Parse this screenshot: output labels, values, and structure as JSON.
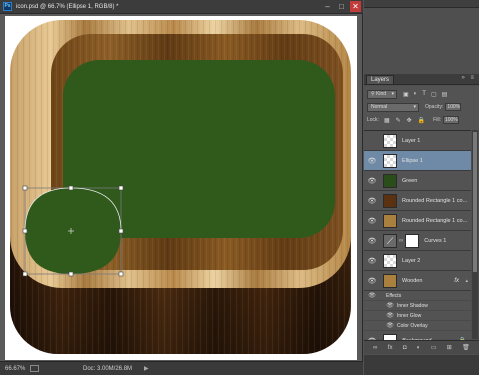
{
  "app": {
    "badge": "Ps",
    "document_title": "icon.psd @ 66.7% (Ellipse 1, RGB/8) *",
    "window_controls": [
      "–",
      "□",
      "✕"
    ]
  },
  "status": {
    "zoom": "66.67%",
    "doc_size": "Doc: 3.00M/26.8M",
    "arrow": "▶"
  },
  "layers_panel": {
    "tab": "Layers",
    "panel_controls": "»  ≡",
    "filter_kind": "Kind",
    "blend_mode": "Normal",
    "opacity_label": "Opacity:",
    "opacity_value": "100%",
    "lock_label": "Lock:",
    "fill_label": "Fill:",
    "fill_value": "100%",
    "layers": [
      {
        "name": "Layer 1",
        "visible": false,
        "thumb": "checker"
      },
      {
        "name": "Ellipse 1",
        "visible": true,
        "thumb": "checker",
        "selected": true
      },
      {
        "name": "Green",
        "visible": true,
        "thumb": "green"
      },
      {
        "name": "Rounded Rectangle 1 co...",
        "visible": true,
        "thumb": "wood-dark"
      },
      {
        "name": "Rounded Rectangle 1 co...",
        "visible": true,
        "thumb": "wood-light"
      },
      {
        "name": "Curves 1",
        "visible": true,
        "thumb": "adj"
      },
      {
        "name": "Layer 2",
        "visible": true,
        "thumb": "checker"
      },
      {
        "name": "Wooden",
        "visible": true,
        "thumb": "wood-light",
        "fx": "fx"
      }
    ],
    "effects_title": "Effects",
    "effects": [
      "Inner Shadow",
      "Inner Glow",
      "Color Overlay"
    ],
    "background_layer": "Background",
    "footer_icons": [
      "link-icon",
      "fx-icon",
      "mask-icon",
      "adjustment-icon",
      "folder-icon",
      "new-layer-icon",
      "trash-icon"
    ],
    "footer_glyphs": [
      "∞",
      "fx",
      "◘",
      "◐",
      "▭",
      "⊞",
      "🗑"
    ]
  },
  "colors": {
    "green": "#2f5a1c",
    "selection": "#6f8aa6"
  }
}
